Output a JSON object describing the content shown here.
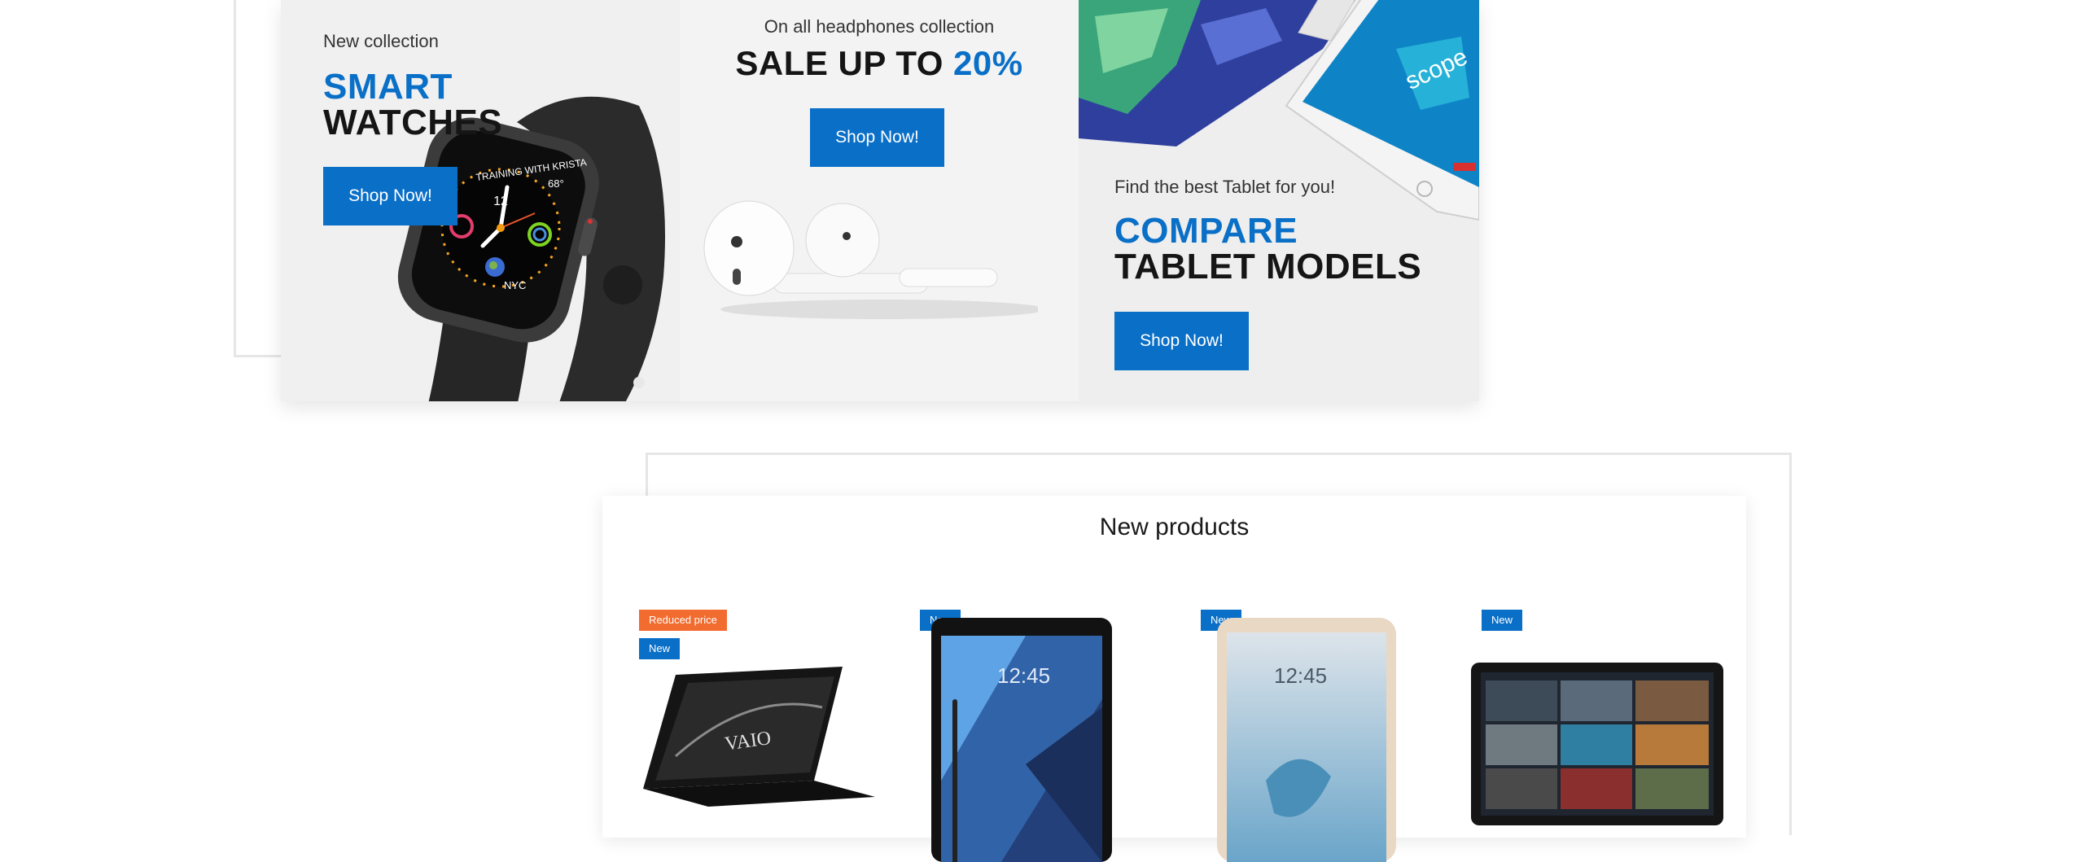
{
  "promo": {
    "watches": {
      "eyebrow": "New collection",
      "title_accent": "SMART",
      "title_dark": "WATCHES",
      "button": "Shop Now!"
    },
    "headphones": {
      "eyebrow": "On all headphones collection",
      "title_dark": "SALE UP TO ",
      "title_accent": "20%",
      "button": "Shop Now!"
    },
    "tablets": {
      "eyebrow": "Find the best Tablet for you!",
      "title_accent": "COMPARE",
      "title_dark": "TABLET MODELS",
      "button": "Shop Now!"
    },
    "watch_face": {
      "time": "12",
      "brand_text": "TRAINING WITH KRISTA",
      "temperature": "68°",
      "city": "NYC"
    },
    "tablet_screen_text": "scope"
  },
  "new_products": {
    "heading": "New products",
    "items": [
      {
        "badges": [
          {
            "label": "Reduced price",
            "kind": "reduced"
          },
          {
            "label": "New",
            "kind": "new"
          }
        ],
        "image": "laptop-vaio",
        "screen_text": "VAIO"
      },
      {
        "badges": [
          {
            "label": "New",
            "kind": "new"
          }
        ],
        "image": "tablet-dark",
        "screen_text": "12:45"
      },
      {
        "badges": [
          {
            "label": "New",
            "kind": "new"
          }
        ],
        "image": "tablet-gold",
        "screen_text": "12:45"
      },
      {
        "badges": [
          {
            "label": "New",
            "kind": "new"
          }
        ],
        "image": "tablet-landscape",
        "screen_text": ""
      }
    ]
  },
  "colors": {
    "accent": "#0a6fc7",
    "badge_reduced": "#f26b2f",
    "badge_new": "#0a6fc7"
  }
}
